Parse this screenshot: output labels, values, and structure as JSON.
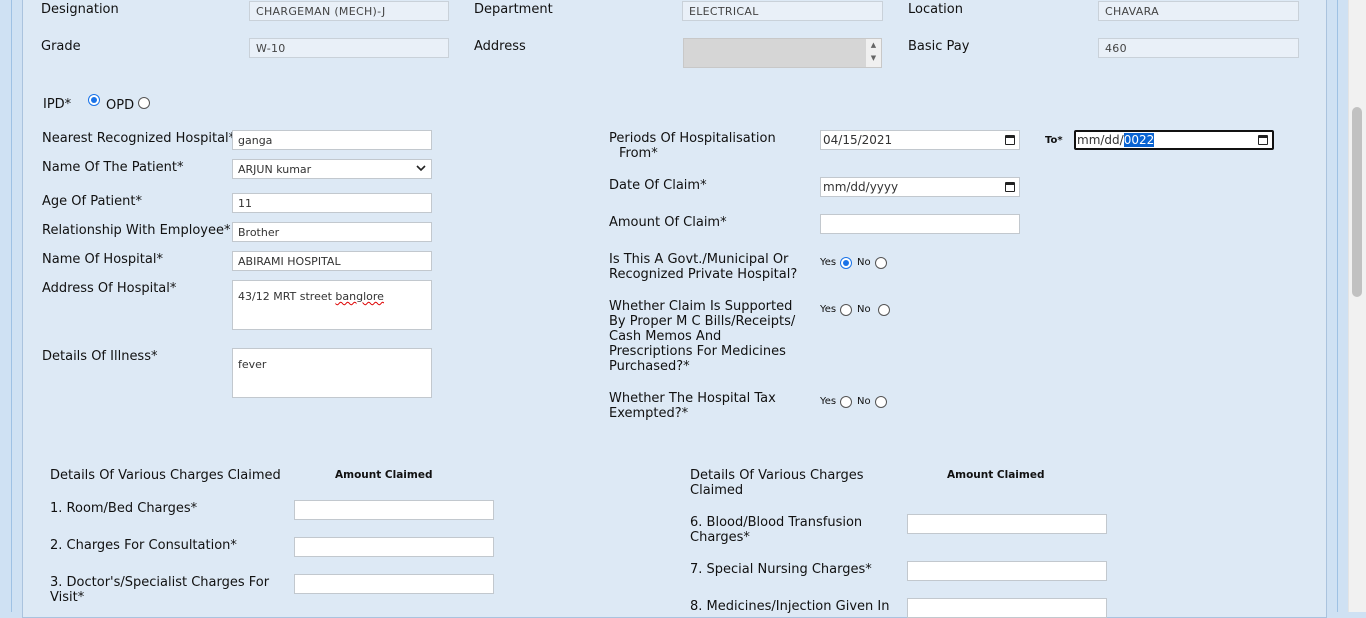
{
  "employee": {
    "designation_label": "Designation",
    "designation_value": "CHARGEMAN (MECH)-J",
    "department_label": "Department",
    "department_value": "ELECTRICAL",
    "location_label": "Location",
    "location_value": "CHAVARA",
    "grade_label": "Grade",
    "grade_value": "W-10",
    "address_label": "Address",
    "basic_pay_label": "Basic Pay",
    "basic_pay_value": "460"
  },
  "type": {
    "ipd_label": "IPD*",
    "opd_label": "OPD",
    "selected": "IPD"
  },
  "patient": {
    "nearest_hospital_label": "Nearest Recognized Hospital*",
    "nearest_hospital_value": "ganga",
    "patient_name_label": "Name Of The Patient*",
    "patient_name_value": "ARJUN kumar",
    "age_label": "Age Of Patient*",
    "age_value": "11",
    "relationship_label": "Relationship With Employee*",
    "relationship_value": "Brother",
    "hospital_name_label": "Name Of Hospital*",
    "hospital_name_value": "ABIRAMI HOSPITAL",
    "hospital_address_label": "Address Of Hospital*",
    "hospital_address_value_a": "43/12 MRT street ",
    "hospital_address_value_b": "banglore",
    "illness_label": "Details Of Illness*",
    "illness_value": "fever"
  },
  "claim": {
    "period_label_line1": "Periods Of Hospitalisation",
    "period_label_line2": "From*",
    "from_value": "04/15/2021",
    "to_label": "To*",
    "to_value_a": "mm/dd/",
    "to_value_b": "0022",
    "date_of_claim_label": "Date Of Claim*",
    "date_of_claim_value": "mm/dd/yyyy",
    "amount_label": "Amount Of Claim*",
    "govt_label_line1": "Is This A Govt./Municipal Or",
    "govt_label_line2": "Recognized Private Hospital?",
    "govt_answer": "Yes",
    "supported_label_lines": [
      "Whether Claim Is Supported",
      "By Proper M C Bills/Receipts/",
      "Cash Memos And",
      "Prescriptions For Medicines",
      "Purchased?*"
    ],
    "tax_label_line1": "Whether The Hospital Tax",
    "tax_label_line2": "Exempted?*",
    "yes_label": "Yes",
    "no_label": "No"
  },
  "charges": {
    "left_header": "Details Of Various Charges Claimed",
    "right_header_line1": "Details Of Various Charges",
    "right_header_line2": "Claimed",
    "amount_header": "Amount Claimed",
    "item1": "1. Room/Bed Charges*",
    "item2": "2. Charges For Consultation*",
    "item3_line1": "3. Doctor's/Specialist Charges For",
    "item3_line2": "Visit*",
    "item6_line1": "6. Blood/Blood Transfusion",
    "item6_line2": "Charges*",
    "item7": "7. Special Nursing Charges*",
    "item8_line1": "8. Medicines/Injection Given In"
  },
  "colors": {
    "accent": "#1a73e8",
    "panel_bg": "#dde9f5",
    "selection": "#0a64d2"
  }
}
